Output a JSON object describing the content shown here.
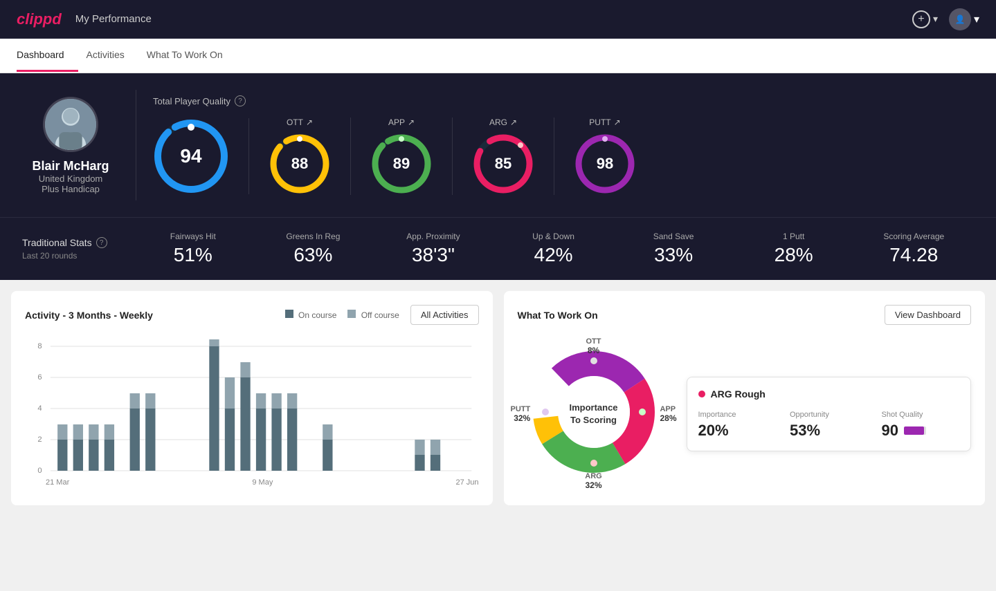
{
  "app": {
    "logo": "clippd",
    "header_title": "My Performance"
  },
  "nav": {
    "tabs": [
      {
        "id": "dashboard",
        "label": "Dashboard",
        "active": true
      },
      {
        "id": "activities",
        "label": "Activities",
        "active": false
      },
      {
        "id": "what-to-work-on",
        "label": "What To Work On",
        "active": false
      }
    ]
  },
  "player": {
    "name": "Blair McHarg",
    "country": "United Kingdom",
    "handicap": "Plus Handicap"
  },
  "quality": {
    "label": "Total Player Quality",
    "main": {
      "value": "94",
      "color": "#2196F3"
    },
    "ott": {
      "label": "OTT",
      "value": "88",
      "color": "#FFC107"
    },
    "app": {
      "label": "APP",
      "value": "89",
      "color": "#4CAF50"
    },
    "arg": {
      "label": "ARG",
      "value": "85",
      "color": "#e91e63"
    },
    "putt": {
      "label": "PUTT",
      "value": "98",
      "color": "#9C27B0"
    }
  },
  "stats": {
    "label": "Traditional Stats",
    "sublabel": "Last 20 rounds",
    "items": [
      {
        "label": "Fairways Hit",
        "value": "51%"
      },
      {
        "label": "Greens In Reg",
        "value": "63%"
      },
      {
        "label": "App. Proximity",
        "value": "38'3\""
      },
      {
        "label": "Up & Down",
        "value": "42%"
      },
      {
        "label": "Sand Save",
        "value": "33%"
      },
      {
        "label": "1 Putt",
        "value": "28%"
      },
      {
        "label": "Scoring Average",
        "value": "74.28"
      }
    ]
  },
  "activity_chart": {
    "title": "Activity - 3 Months - Weekly",
    "legend": [
      {
        "label": "On course",
        "color": "#546E7A"
      },
      {
        "label": "Off course",
        "color": "#90A4AE"
      }
    ],
    "all_activities_btn": "All Activities",
    "x_labels": [
      "21 Mar",
      "9 May",
      "27 Jun"
    ],
    "y_labels": [
      "0",
      "2",
      "4",
      "6",
      "8"
    ]
  },
  "what_to_work_on": {
    "title": "What To Work On",
    "view_dashboard_btn": "View Dashboard",
    "donut_center": "Importance\nTo Scoring",
    "segments": [
      {
        "label": "OTT",
        "value": "8%",
        "color": "#FFC107"
      },
      {
        "label": "APP",
        "value": "28%",
        "color": "#4CAF50"
      },
      {
        "label": "ARG",
        "value": "32%",
        "color": "#e91e63"
      },
      {
        "label": "PUTT",
        "value": "32%",
        "color": "#9C27B0"
      }
    ],
    "info_card": {
      "title": "ARG Rough",
      "dot_color": "#e91e63",
      "metrics": [
        {
          "label": "Importance",
          "value": "20%"
        },
        {
          "label": "Opportunity",
          "value": "53%"
        },
        {
          "label": "Shot Quality",
          "value": "90"
        }
      ]
    }
  },
  "icons": {
    "plus": "+",
    "chevron_down": "▾",
    "arrow_up_right": "↗",
    "info": "?"
  }
}
